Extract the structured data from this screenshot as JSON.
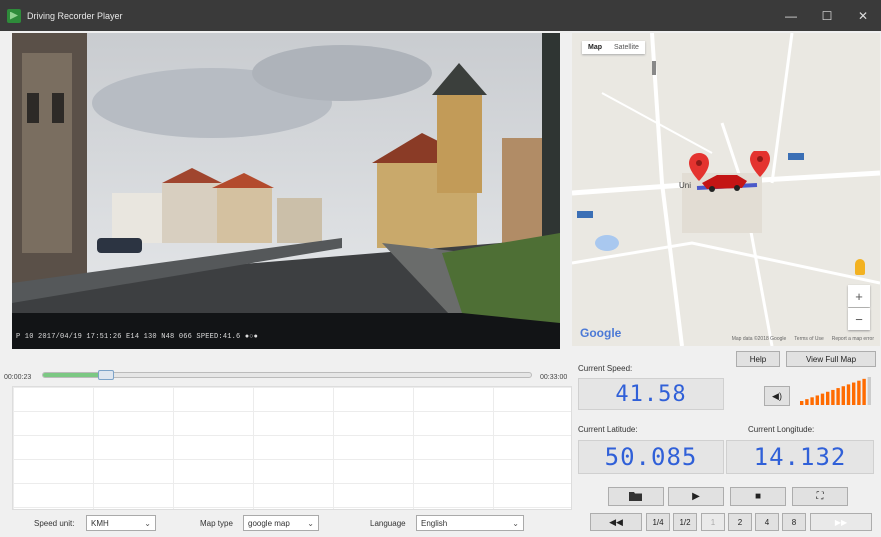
{
  "window": {
    "title": "Driving Recorder Player",
    "minimize": "—",
    "maximize": "☐",
    "close": "✕"
  },
  "video": {
    "overlay_text": "P 10   2017/04/19 17:51:26 E14 130 N48 066 SPEED:41.6 ●○●"
  },
  "map": {
    "tabs": [
      "Map",
      "Satellite"
    ],
    "active_tab": "Map",
    "logo": "Google",
    "footer": [
      "Map data ©2018 Google",
      "Terms of Use",
      "Report a map error"
    ],
    "place_label": "Uni",
    "zoom_in": "+",
    "zoom_out": "−",
    "help_label": "Help",
    "view_full_label": "View Full Map"
  },
  "playback": {
    "elapsed": "00:00:23",
    "total": "00:33:00",
    "progress": 0.13
  },
  "speed": {
    "label": "Current Speed:",
    "value": "41.58"
  },
  "volume": {
    "icon": "◀)",
    "level": 0.9
  },
  "latitude": {
    "label": "Current Latitude:",
    "value": "50.085"
  },
  "longitude": {
    "label": "Current Longitude:",
    "value": "14.132"
  },
  "controls": {
    "open": "open-folder-icon",
    "play": "▶",
    "stop": "■",
    "fullscreen": "⛶"
  },
  "speed_controls": {
    "rewind": "◀◀",
    "speeds": [
      "1/4",
      "1/2",
      "1",
      "2",
      "4",
      "8"
    ],
    "forward": "▶▶"
  },
  "settings": {
    "speed_unit_label": "Speed unit:",
    "speed_unit_value": "KMH",
    "map_type_label": "Map type",
    "map_type_value": "google map",
    "language_label": "Language",
    "language_value": "English"
  },
  "colors": {
    "accent": "#3060d8",
    "progress": "#7cc883",
    "titlebar": "#3a3a3a",
    "volume": "#ff6b00"
  }
}
